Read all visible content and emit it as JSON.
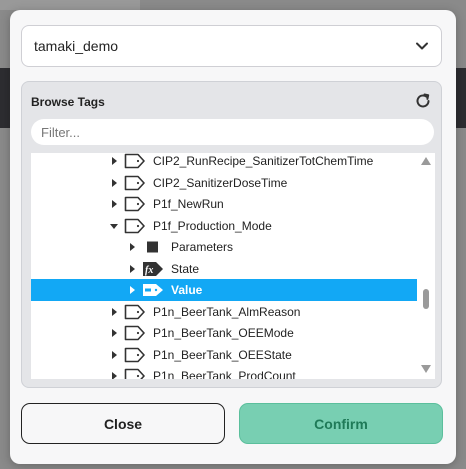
{
  "provider_select": {
    "value": "tamaki_demo"
  },
  "browse": {
    "title": "Browse Tags",
    "filter_placeholder": "Filter..."
  },
  "tree_rows": [
    {
      "label": "CIP2_RunRecipe_SanitizerTotChemTime",
      "icon": "tag-icon",
      "caret": "collapsed",
      "depth": 1
    },
    {
      "label": "CIP2_SanitizerDoseTime",
      "icon": "tag-icon",
      "caret": "collapsed",
      "depth": 1
    },
    {
      "label": "P1f_NewRun",
      "icon": "tag-icon",
      "caret": "collapsed",
      "depth": 1
    },
    {
      "label": "P1f_Production_Mode",
      "icon": "tag-icon",
      "caret": "expanded",
      "depth": 1
    },
    {
      "label": "Parameters",
      "icon": "folder-square-icon",
      "caret": "collapsed",
      "depth": 2
    },
    {
      "label": "State",
      "icon": "expression-tag-icon",
      "caret": "collapsed",
      "depth": 2
    },
    {
      "label": "Value",
      "icon": "value-tag-icon",
      "caret": "collapsed",
      "depth": 2,
      "selected": true
    },
    {
      "label": "P1n_BeerTank_AlmReason",
      "icon": "tag-icon",
      "caret": "collapsed",
      "depth": 1
    },
    {
      "label": "P1n_BeerTank_OEEMode",
      "icon": "tag-icon",
      "caret": "collapsed",
      "depth": 1
    },
    {
      "label": "P1n_BeerTank_OEEState",
      "icon": "tag-icon",
      "caret": "collapsed",
      "depth": 1
    },
    {
      "label": "P1n_BeerTank_ProdCount",
      "icon": "tag-icon",
      "caret": "collapsed",
      "depth": 1
    }
  ],
  "buttons": {
    "close": "Close",
    "confirm": "Confirm"
  },
  "colors": {
    "selected_row": "#12a8f5",
    "confirm_bg": "#78cfb2",
    "confirm_text": "#1f7a58"
  }
}
